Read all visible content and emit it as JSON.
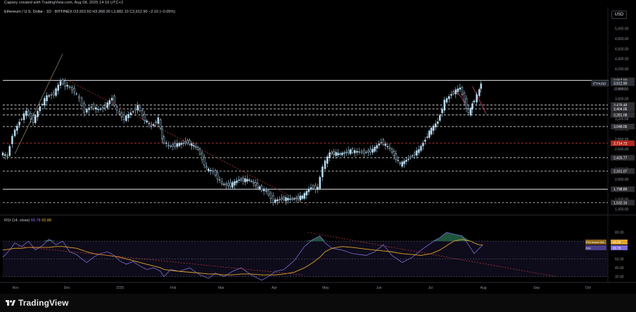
{
  "header": {
    "credit": "Capsey created with TradingView.com, Aug 08, 2025 14:16 UTC+2",
    "currency_button": "USD"
  },
  "legend": {
    "symbol": "Ethereum / U.S. Dollar · 1D · BITFINEX",
    "ohlc": "O3,915.60 H3,968.30 L3,882.10 C3,912.90 −2.10 (−0.05%)"
  },
  "rsi_legend": {
    "label": "RSI (14, close)",
    "v1": "65.78",
    "v2": "65.88"
  },
  "brand": {
    "name": "TradingView"
  },
  "colors": {
    "background": "#000000",
    "candle": "#b9dcf2",
    "rsi_line": "#7e6ad6",
    "rsi_ma": "#e0a52b",
    "overbought_fill": "#2b7a55",
    "dashed_level": "#d9dbe0",
    "red_level": "#c43b3b",
    "badge_bg": "#2e2e33"
  },
  "chart_data": [
    {
      "type": "line",
      "title": "Ethereum / U.S. Dollar · 1D · BITFINEX",
      "ylabel": "USD",
      "x_ticks": [
        "Nov",
        "Dec",
        "2025",
        "Feb",
        "Mar",
        "Apr",
        "May",
        "Jun",
        "Jul",
        "Aug",
        "Sep",
        "Oct"
      ],
      "y_ticks": [
        "5,000.00",
        "4,800.00",
        "4,600.00",
        "4,400.00",
        "4,200.00",
        "3,800.00",
        "3,600.00",
        "3,400.00",
        "3,200.00",
        "3,000.00",
        "2,800.00",
        "2,600.00",
        "2,400.00",
        "2,200.00",
        "2,000.00",
        "1,800.00",
        "1,600.00",
        "1,400.00"
      ],
      "ylim": [
        1340,
        5150
      ],
      "series": [
        {
          "name": "ETHUSD",
          "x": [
            "Nov 01",
            "Nov 05",
            "Nov 08",
            "Nov 12",
            "Nov 16",
            "Nov 20",
            "Nov 24",
            "Nov 28",
            "Dec 02",
            "Dec 06",
            "Dec 10",
            "Dec 14",
            "Dec 17",
            "Dec 20",
            "Dec 24",
            "Dec 28",
            "Jan 01",
            "Jan 05",
            "Jan 08",
            "Jan 12",
            "Jan 16",
            "Jan 20",
            "Jan 24",
            "Jan 28",
            "Feb 01",
            "Feb 03",
            "Feb 07",
            "Feb 12",
            "Feb 18",
            "Feb 24",
            "Mar 01",
            "Mar 05",
            "Mar 10",
            "Mar 15",
            "Mar 20",
            "Mar 26",
            "Apr 01",
            "Apr 05",
            "Apr 09",
            "Apr 14",
            "Apr 20",
            "Apr 26",
            "May 01",
            "May 05",
            "May 08",
            "May 12",
            "May 18",
            "May 24",
            "Jun 01",
            "Jun 06",
            "Jun 11",
            "Jun 16",
            "Jun 22",
            "Jun 28",
            "Jul 03",
            "Jul 09",
            "Jul 14",
            "Jul 18",
            "Jul 22",
            "Jul 27",
            "Aug 01",
            "Aug 03",
            "Aug 06",
            "Aug 08"
          ],
          "values": [
            2520,
            2450,
            2880,
            3150,
            3350,
            3150,
            3450,
            3650,
            3700,
            3950,
            3850,
            3750,
            3600,
            3350,
            3450,
            3380,
            3450,
            3620,
            3350,
            3200,
            3320,
            3450,
            3180,
            3050,
            3200,
            2800,
            2650,
            2690,
            2740,
            2600,
            2200,
            2150,
            1900,
            1880,
            1990,
            1980,
            1820,
            1760,
            1560,
            1610,
            1600,
            1650,
            1840,
            1820,
            2250,
            2520,
            2500,
            2560,
            2530,
            2580,
            2750,
            2600,
            2290,
            2440,
            2580,
            2940,
            3150,
            3550,
            3700,
            3820,
            3300,
            3500,
            3660,
            3912.9
          ]
        }
      ],
      "levels": [
        {
          "value": 3967.99,
          "label": "3,967.99",
          "style": "solid"
        },
        {
          "value": 3912.9,
          "label": "3,912.90",
          "style": "badge",
          "symbol": "ETHUSD",
          "sub": "17:43:52"
        },
        {
          "value": 3478.48,
          "label": "3,478.48",
          "style": "dashed"
        },
        {
          "value": 3400.0,
          "label": "3,404.06",
          "style": "dashed"
        },
        {
          "value": 3281.08,
          "label": "3,281.08",
          "style": "dashed"
        },
        {
          "value": 3048.05,
          "label": "3,048.05",
          "style": "dashed"
        },
        {
          "value": 2714.72,
          "label": "2,714.72",
          "style": "red"
        },
        {
          "value": 2425.77,
          "label": "2,425.77",
          "style": "dashed"
        },
        {
          "value": 2161.07,
          "label": "2,161.07",
          "style": "dashed"
        },
        {
          "value": 1798.85,
          "label": "1,798.85",
          "style": "solid"
        },
        {
          "value": 1532.16,
          "label": "1,532.16",
          "style": "dashed"
        }
      ]
    },
    {
      "type": "line",
      "title": "RSI (14, close)",
      "y_ticks": [
        "80.00",
        "70.00",
        "50.00",
        "40.00",
        "30.00"
      ],
      "ylim": [
        25,
        90
      ],
      "series": [
        {
          "name": "RSI",
          "values": [
            52,
            60,
            68,
            64,
            70,
            60,
            65,
            72,
            66,
            70,
            58,
            55,
            50,
            46,
            52,
            56,
            58,
            54,
            48,
            44,
            47,
            42,
            38,
            40,
            36,
            30,
            38,
            36,
            40,
            32,
            28,
            34,
            30,
            36,
            40,
            32,
            26,
            30,
            36,
            38,
            48,
            64,
            72,
            76,
            68,
            62,
            60,
            56,
            54,
            58,
            66,
            54,
            46,
            52,
            60,
            68,
            74,
            80,
            78,
            76,
            62,
            56,
            62,
            65.78
          ]
        },
        {
          "name": "RSI-based MA",
          "values": [
            60,
            61,
            62,
            62,
            63,
            63,
            63,
            63,
            64,
            64,
            63,
            62,
            60,
            58,
            56,
            55,
            54,
            53,
            52,
            50,
            48,
            46,
            44,
            42,
            40,
            38,
            37,
            36,
            35,
            34,
            33,
            33,
            32,
            32,
            33,
            33,
            32,
            32,
            32,
            33,
            35,
            40,
            46,
            52,
            58,
            62,
            64,
            63,
            61,
            60,
            59,
            58,
            56,
            55,
            54,
            56,
            60,
            65,
            70,
            72,
            70,
            68,
            66,
            65.88
          ]
        }
      ],
      "badges": [
        {
          "label": "RSI-based MA",
          "value": "65.88"
        },
        {
          "label": "RSI",
          "value": "65.78"
        }
      ]
    }
  ]
}
